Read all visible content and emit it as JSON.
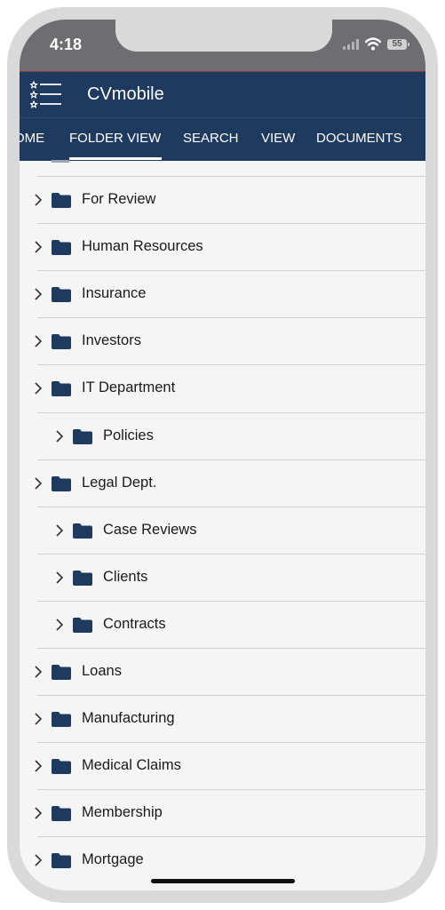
{
  "status_bar": {
    "time": "4:18",
    "battery": "55",
    "signal_icon": "signal-bars-icon",
    "wifi_icon": "wifi-icon"
  },
  "app_bar": {
    "title": "CVmobile",
    "menu_icon": "list-menu-icon",
    "background": "#1e3a5f"
  },
  "tabs": [
    {
      "label": "HOME",
      "visible_text": "OME",
      "active": false
    },
    {
      "label": "FOLDER VIEW",
      "active": true
    },
    {
      "label": "SEARCH",
      "active": false
    },
    {
      "label": "VIEW",
      "active": false
    },
    {
      "label": "DOCUMENTS",
      "active": false
    }
  ],
  "folders": [
    {
      "name": "For Review",
      "level": 0
    },
    {
      "name": "Human Resources",
      "level": 0
    },
    {
      "name": "Insurance",
      "level": 0
    },
    {
      "name": "Investors",
      "level": 0
    },
    {
      "name": "IT Department",
      "level": 0
    },
    {
      "name": "Policies",
      "level": 1
    },
    {
      "name": "Legal Dept.",
      "level": 0
    },
    {
      "name": "Case Reviews",
      "level": 1
    },
    {
      "name": "Clients",
      "level": 1
    },
    {
      "name": "Contracts",
      "level": 1
    },
    {
      "name": "Loans",
      "level": 0
    },
    {
      "name": "Manufacturing",
      "level": 0
    },
    {
      "name": "Medical Claims",
      "level": 0
    },
    {
      "name": "Membership",
      "level": 0
    },
    {
      "name": "Mortgage",
      "level": 0
    }
  ],
  "colors": {
    "folder_icon": "#1e3a5f",
    "divider": "#d2d2d2",
    "list_background": "#f5f5f5"
  }
}
